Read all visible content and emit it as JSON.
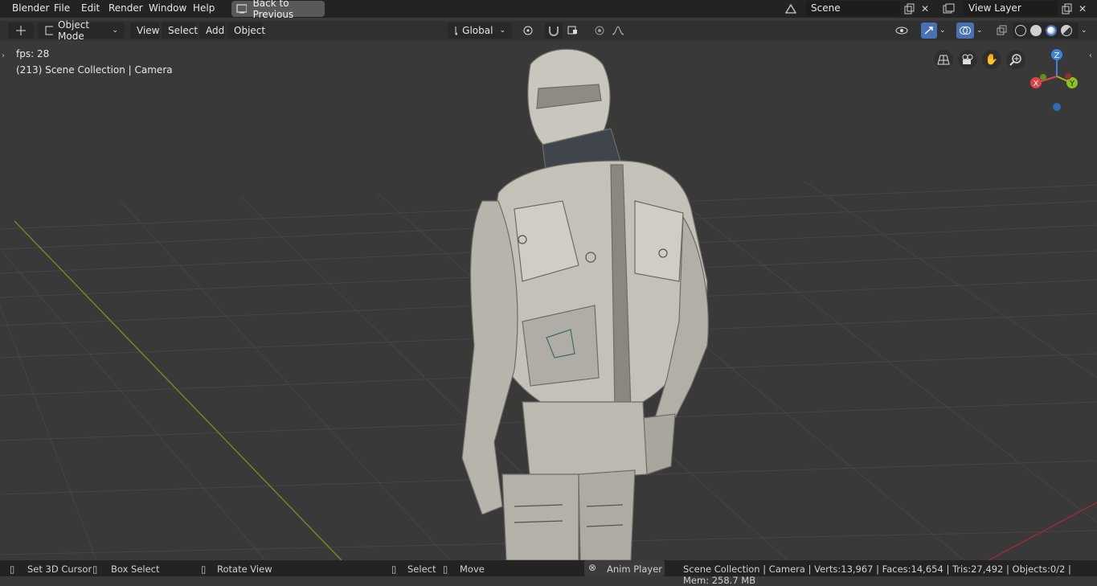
{
  "topbar": {
    "menus": [
      "Blender",
      "File",
      "Edit",
      "Render",
      "Window",
      "Help"
    ],
    "back_button": "Back to Previous",
    "scene": "Scene",
    "view_layer": "View Layer"
  },
  "header": {
    "mode": "Object Mode",
    "menus": [
      "View",
      "Select",
      "Add",
      "Object"
    ],
    "transform_orientation": "Global"
  },
  "viewport": {
    "fps": "fps: 28",
    "info": "(213) Scene Collection | Camera",
    "gizmo": {
      "x": "X",
      "y": "Y",
      "z": "Z"
    }
  },
  "statusbar": {
    "set_cursor": "Set 3D Cursor",
    "box_select": "Box Select",
    "rotate_view": "Rotate View",
    "select": "Select",
    "move": "Move",
    "anim_player": "Anim Player",
    "stats": "Scene Collection | Camera | Verts:13,967 | Faces:14,654 | Tris:27,492 | Objects:0/2 | Mem: 258.7 MB"
  },
  "colors": {
    "x_axis": "#e0424a",
    "y_axis": "#8cc21c",
    "z_axis": "#3a84d9",
    "accent": "#4772b3"
  }
}
